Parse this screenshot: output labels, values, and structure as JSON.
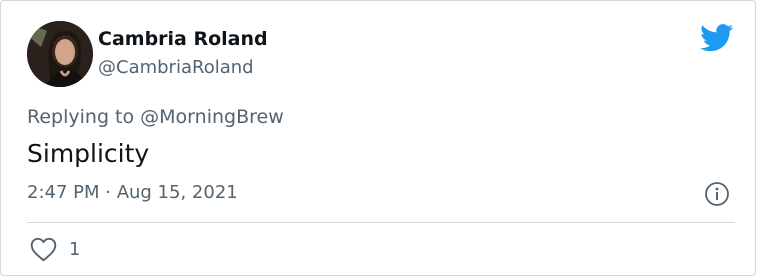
{
  "user": {
    "name": "Cambria Roland",
    "handle": "@CambriaRoland",
    "avatar_icon": "profile-photo"
  },
  "tweet": {
    "replying_prefix": "Replying to ",
    "replying_to": "@MorningBrew",
    "text": "Simplicity",
    "timestamp": "2:47 PM · Aug 15, 2021"
  },
  "actions": {
    "like_icon": "heart-outline-icon",
    "like_count": "1",
    "info_icon": "info-icon"
  },
  "brand": {
    "logo_icon": "twitter-bird-icon",
    "accent_color": "#1d9bf0",
    "muted_text_color": "#536471"
  }
}
